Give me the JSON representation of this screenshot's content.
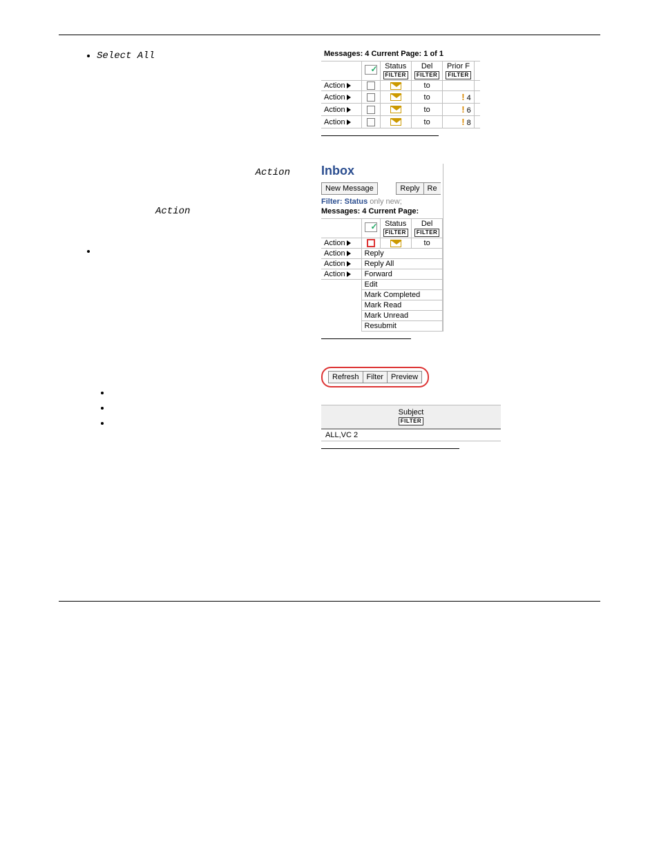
{
  "labels": {
    "select_all": "Select All",
    "action": "Action",
    "action2": "Action"
  },
  "shot1": {
    "header_line": "Messages: 4  Current Page: 1 of 1",
    "col_status": "Status",
    "col_del": "Del",
    "col_prior": "Prior F",
    "filter": "FILTER",
    "action_label": "Action",
    "to": "to",
    "priorities": [
      "",
      "4",
      "6",
      "8"
    ]
  },
  "shot2": {
    "title": "Inbox",
    "btn_new": "New Message",
    "btn_reply": "Reply",
    "btn_re": "Re",
    "filter_label": "Filter: Status",
    "filter_value": "only new;",
    "msg_line": "Messages: 4  Current Page:",
    "col_status": "Status",
    "col_del": "Del",
    "filter": "FILTER",
    "action_label": "Action",
    "to": "to",
    "menu": [
      "Reply",
      "Reply All",
      "Forward",
      "Edit",
      "Mark Completed",
      "Mark Read",
      "Mark Unread",
      "Resubmit"
    ]
  },
  "shot3": {
    "btn_refresh": "Refresh",
    "btn_filter": "Filter",
    "btn_preview": "Preview"
  },
  "shot4": {
    "col_subject": "Subject",
    "filter": "FILTER",
    "row_text": "ALL,VC 2"
  }
}
